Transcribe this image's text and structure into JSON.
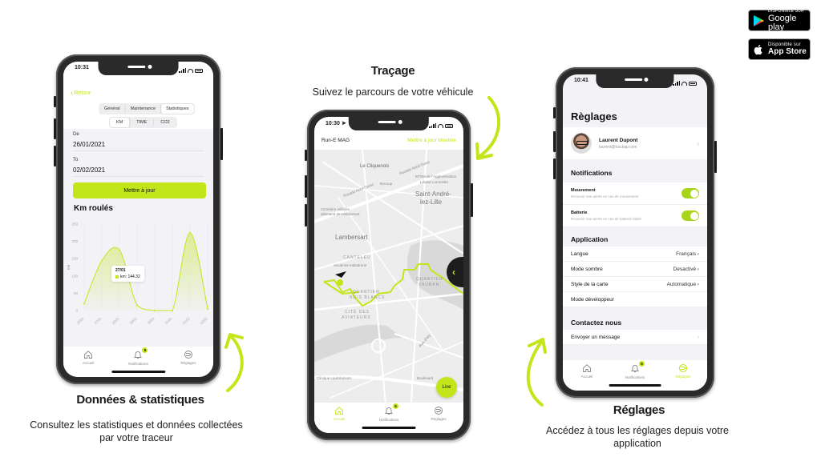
{
  "store_badges": {
    "google_play": {
      "top": "DISPONIBLE SUR",
      "name": "Google play"
    },
    "app_store": {
      "top": "Disponible sur",
      "name": "App Store"
    }
  },
  "sections": {
    "stats": {
      "title": "Données & statistiques",
      "desc_line1": "Consultez les statistiques et données collectées",
      "desc_line2": "par votre traceur"
    },
    "tracking": {
      "title": "Traçage",
      "desc": "Suivez le parcours de votre véhicule"
    },
    "settings": {
      "title": "Réglages",
      "desc_line1": "Accédez à tous les réglages depuis votre",
      "desc_line2": "application"
    }
  },
  "accent_color": "#c3e61b",
  "tabbar": {
    "items": [
      {
        "label": "Accueil",
        "icon": "home-icon"
      },
      {
        "label": "Notifications",
        "icon": "bell-icon",
        "badge": "5"
      },
      {
        "label": "Réglages",
        "icon": "settings-icon"
      }
    ]
  },
  "phone_stats": {
    "time": "10:31",
    "back_label": "Retour",
    "main_tabs": [
      "Général",
      "Maintenance",
      "Statistiques"
    ],
    "main_tab_active": "Statistiques",
    "metric_tabs": [
      "KM",
      "TIME",
      "CO2"
    ],
    "metric_tab_active": "KM",
    "from_label": "De",
    "from_value": "26/01/2021",
    "to_label": "To",
    "to_value": "02/02/2021",
    "update_button": "Mettre à jour",
    "chart_title": "Km roulés",
    "tooltip": {
      "date": "27/01",
      "label": "km: 144.32"
    }
  },
  "chart_data": {
    "type": "area",
    "title": "Km roulés",
    "xlabel": "",
    "ylabel": "KM",
    "categories": [
      "26/01",
      "27/01",
      "28/01",
      "29/01",
      "30/01",
      "31/01",
      "01/02",
      "02/02"
    ],
    "series": [
      {
        "name": "km",
        "values": [
          20,
          144.32,
          175,
          15,
          0,
          0,
          225,
          5
        ]
      }
    ],
    "yticks": [
      0,
      50,
      100,
      150,
      200,
      250
    ],
    "ylim": [
      0,
      250
    ],
    "grid": true
  },
  "phone_map": {
    "time": "10:30",
    "title": "Run-E MAG",
    "update_link": "Mettre à jour timeline",
    "live_button": "Live",
    "labels": {
      "le_cliquenois": "Le Cliquenois",
      "rocade1": "Rocade Nord-Ouest",
      "rocade2": "Rocade Nord-Ouest",
      "bocoop": "Bocoop",
      "epsm": "EPSM de l'Agglomération",
      "epsm2": "Lilloise Lommelet",
      "saint_andre": "Saint-André-",
      "saint_andre2": "lez-Lille",
      "cimetiere": "Cimetière militaire",
      "cimetiere2": "allemand de Lambersart",
      "lambersart": "Lambersart",
      "canteleu": "CANTELEU",
      "maladrerie": "Ancienne maladrerie",
      "vauban": "QUARTIER",
      "vauban2": "VAUBAN",
      "bois_blancs": "QUARTIER",
      "bois_blancs2": "BOIS BLANCS",
      "aviateurs": "CITÉ DES",
      "aviateurs2": "AVIATEURS",
      "rue_isly": "Rue d'Isly",
      "clinique": "Clinique Lautréamont",
      "boulevard": "Boulevard"
    }
  },
  "phone_settings": {
    "time": "10:41",
    "title": "Règlages",
    "profile": {
      "name": "Laurent Dupont",
      "email": "laurent@trackap.com"
    },
    "notifications_header": "Notifications",
    "toggles": [
      {
        "title": "Mouvement",
        "subtitle": "Recevoir une alerte en cas de mouvement",
        "on": true
      },
      {
        "title": "Batterie",
        "subtitle": "Recevoir une alerte en cas de batterie faible",
        "on": true
      }
    ],
    "application_header": "Application",
    "app_rows": [
      {
        "label": "Langue",
        "value": "Français"
      },
      {
        "label": "Mode sombre",
        "value": "Desactivé"
      },
      {
        "label": "Style de la carte",
        "value": "Automatique"
      },
      {
        "label": "Mode développeur",
        "value": null
      }
    ],
    "contact_header": "Contactez nous",
    "contact_row": "Envoyer un message"
  }
}
